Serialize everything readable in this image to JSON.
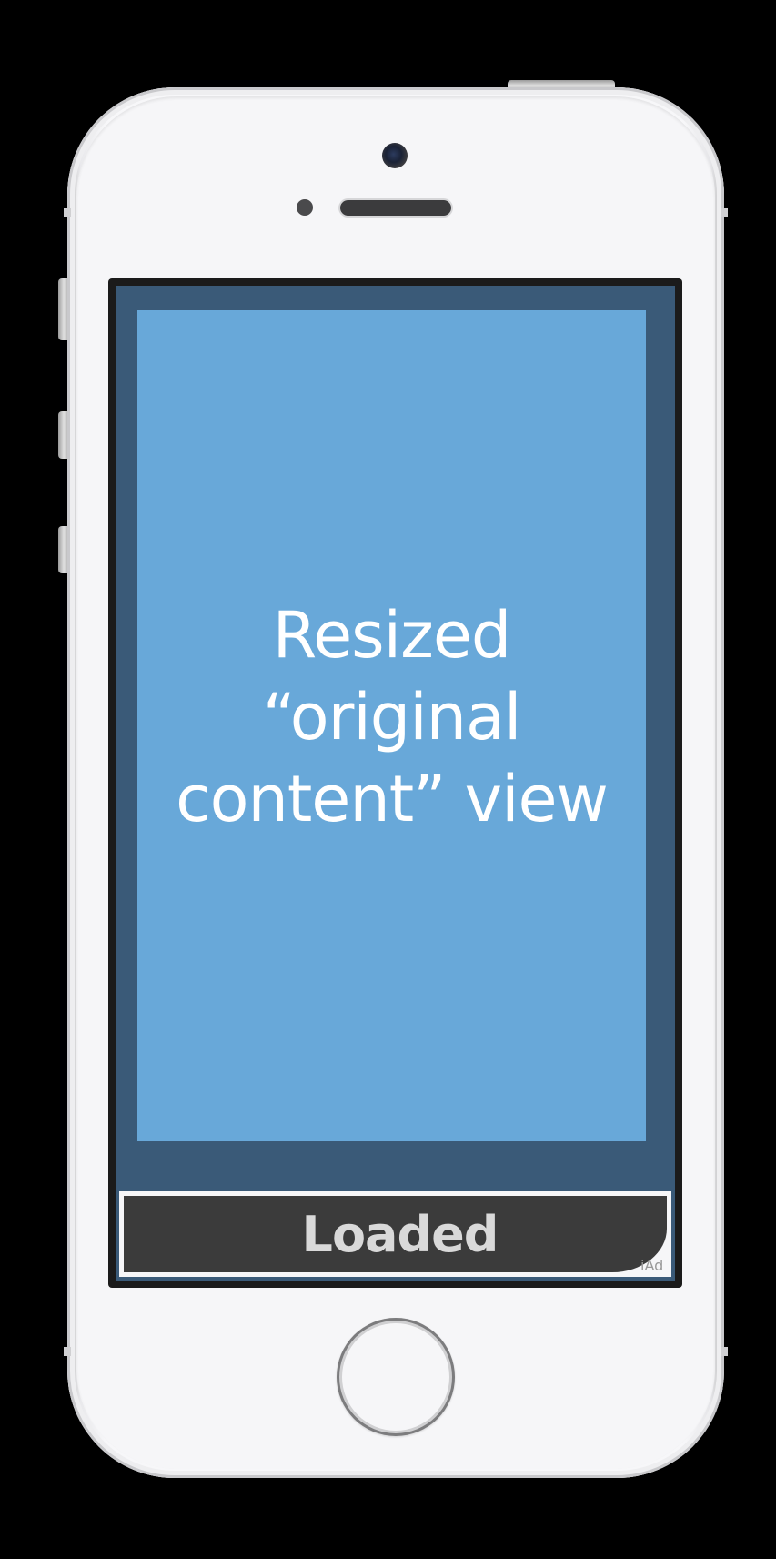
{
  "device": {
    "model": "iphone",
    "color": "#f6f6f8"
  },
  "screen": {
    "background_color": "#3a5a78",
    "content_view": {
      "label": "Resized\n“original\ncontent” view",
      "background_color": "#68a8d9"
    },
    "ad_banner": {
      "label": "Loaded",
      "badge": "iAd",
      "background_color": "#3b3b3b"
    }
  }
}
